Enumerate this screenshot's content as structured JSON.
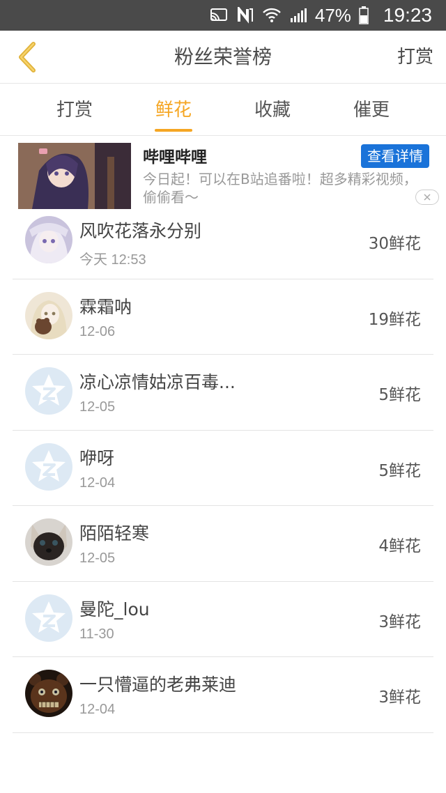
{
  "status_bar": {
    "battery": "47%",
    "time": "19:23"
  },
  "header": {
    "title": "粉丝荣誉榜",
    "action": "打赏"
  },
  "tabs": [
    {
      "label": "打赏",
      "active": false
    },
    {
      "label": "鲜花",
      "active": true
    },
    {
      "label": "收藏",
      "active": false
    },
    {
      "label": "催更",
      "active": false
    }
  ],
  "ad": {
    "title": "哔哩哔哩",
    "description": "今日起！可以在B站追番啦！超多精彩视频，偷偷看〜",
    "button": "查看详情"
  },
  "rank_list": [
    {
      "name": "风吹花落永分别",
      "date": "今天 12:53",
      "amount": "30鲜花",
      "avatar": "anime-girl-white-hair"
    },
    {
      "name": "霖霜呐",
      "date": "12-06",
      "amount": "19鲜花",
      "avatar": "anime-girl-bear"
    },
    {
      "name": "凉心凉情姑凉百毒...",
      "date": "12-05",
      "amount": "5鲜花",
      "avatar": "default-z"
    },
    {
      "name": "咿呀",
      "date": "12-04",
      "amount": "5鲜花",
      "avatar": "default-z"
    },
    {
      "name": "陌陌轻寒",
      "date": "12-05",
      "amount": "4鲜花",
      "avatar": "siamese-cat"
    },
    {
      "name": "曼陀_lou",
      "date": "11-30",
      "amount": "3鲜花",
      "avatar": "default-z"
    },
    {
      "name": "一只懵逼的老弗莱迪",
      "date": "12-04",
      "amount": "3鲜花",
      "avatar": "freddy-bear"
    }
  ],
  "colors": {
    "accent": "#f5a623",
    "status_bar": "#4a4a4a",
    "ad_button": "#1a73d9",
    "default_avatar": "#dde9f4"
  }
}
